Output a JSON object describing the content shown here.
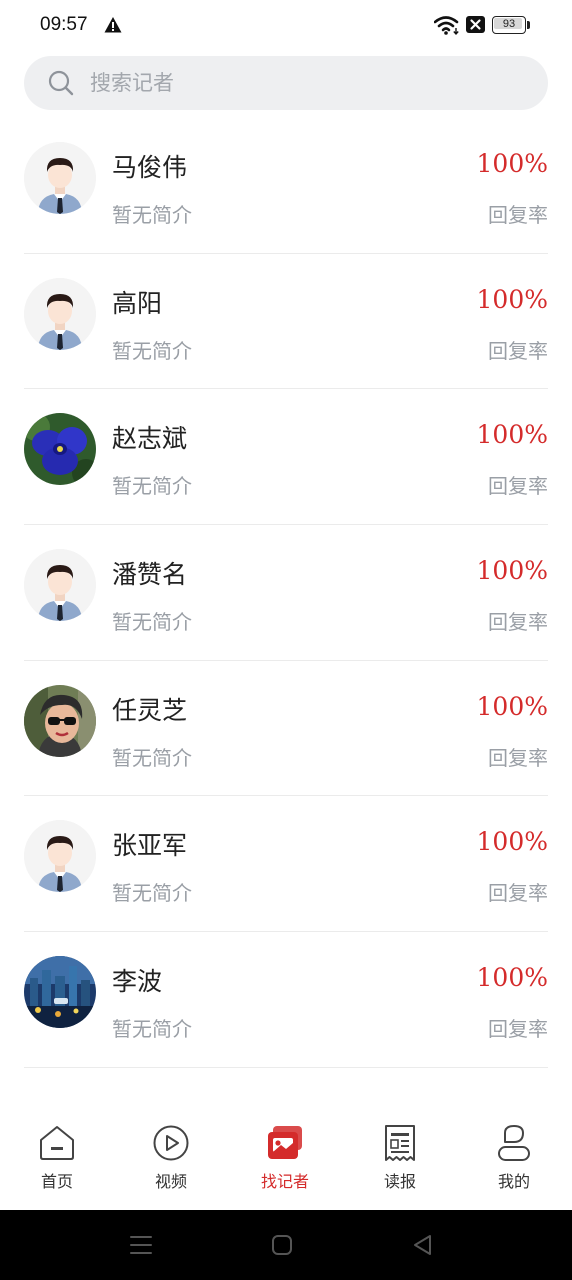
{
  "status": {
    "time": "09:57",
    "battery": "93",
    "battery_fraction": 0.93,
    "icons": [
      "warning-icon",
      "wifi-icon",
      "no-sim-icon",
      "battery-icon"
    ]
  },
  "search": {
    "placeholder": "搜索记者",
    "value": ""
  },
  "reporters": [
    {
      "name": "马俊伟",
      "bio": "暂无简介",
      "rate": "100%",
      "rate_label": "回复率",
      "avatar": "default-man"
    },
    {
      "name": "高阳",
      "bio": "暂无简介",
      "rate": "100%",
      "rate_label": "回复率",
      "avatar": "default-man"
    },
    {
      "name": "赵志斌",
      "bio": "暂无简介",
      "rate": "100%",
      "rate_label": "回复率",
      "avatar": "blue-flower-photo"
    },
    {
      "name": "潘赞名",
      "bio": "暂无简介",
      "rate": "100%",
      "rate_label": "回复率",
      "avatar": "default-man"
    },
    {
      "name": "任灵芝",
      "bio": "暂无简介",
      "rate": "100%",
      "rate_label": "回复率",
      "avatar": "woman-sunglasses-photo"
    },
    {
      "name": "张亚军",
      "bio": "暂无简介",
      "rate": "100%",
      "rate_label": "回复率",
      "avatar": "default-man"
    },
    {
      "name": "李波",
      "bio": "暂无简介",
      "rate": "100%",
      "rate_label": "回复率",
      "avatar": "city-night-photo"
    }
  ],
  "tabs": [
    {
      "label": "首页",
      "icon": "home-icon"
    },
    {
      "label": "视频",
      "icon": "play-icon"
    },
    {
      "label": "找记者",
      "icon": "reporter-icon",
      "active": true
    },
    {
      "label": "读报",
      "icon": "newspaper-icon"
    },
    {
      "label": "我的",
      "icon": "profile-icon"
    }
  ],
  "colors": {
    "accent": "#d42b2b",
    "muted": "#9a9fa6",
    "search_bg": "#eeeff1"
  },
  "system_nav": [
    "menu-icon",
    "home-square-icon",
    "back-triangle-icon"
  ]
}
